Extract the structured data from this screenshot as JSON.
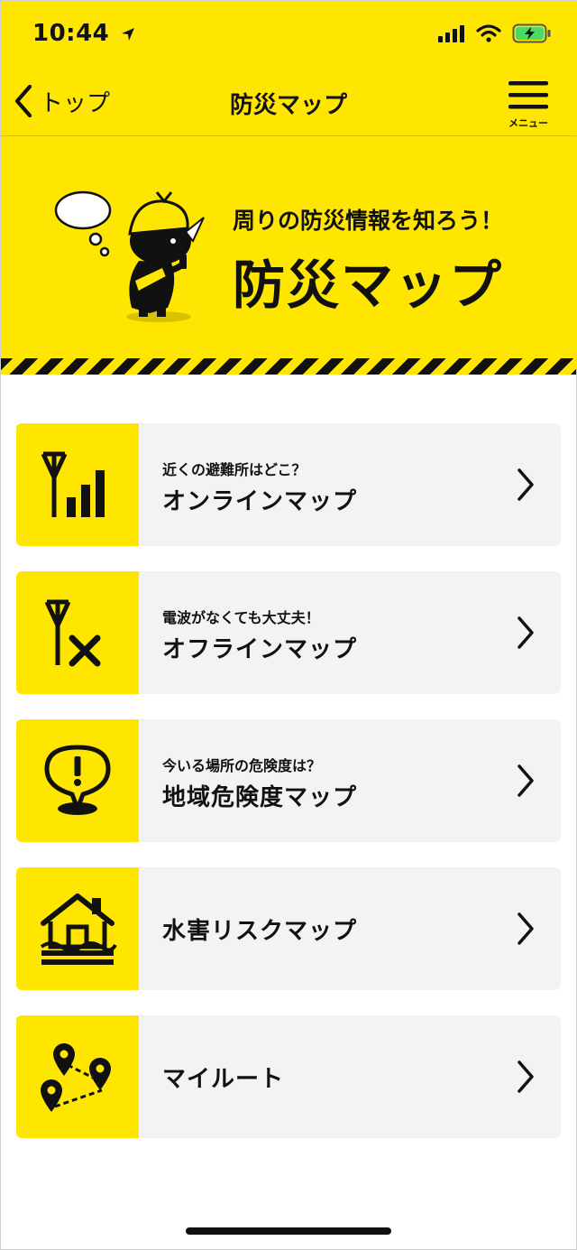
{
  "status_bar": {
    "time": "10:44"
  },
  "nav": {
    "back_label": "トップ",
    "title": "防災マップ",
    "menu_label": "メニュー"
  },
  "hero": {
    "subtitle": "周りの防災情報を知ろう！",
    "title": "防災マップ"
  },
  "menu": {
    "items": [
      {
        "subtitle": "近くの避難所はどこ？",
        "title": "オンラインマップ",
        "icon": "signal-bars-icon"
      },
      {
        "subtitle": "電波がなくても大丈夫！",
        "title": "オフラインマップ",
        "icon": "no-signal-icon"
      },
      {
        "subtitle": "今いる場所の危険度は？",
        "title": "地域危険度マップ",
        "icon": "warning-pin-icon"
      },
      {
        "title": "水害リスクマップ",
        "icon": "flooded-house-icon"
      },
      {
        "title": "マイルート",
        "icon": "route-pins-icon"
      }
    ]
  },
  "colors": {
    "brand_yellow": "#ffe600",
    "card_background": "#f3f3f3",
    "text": "#111111"
  }
}
